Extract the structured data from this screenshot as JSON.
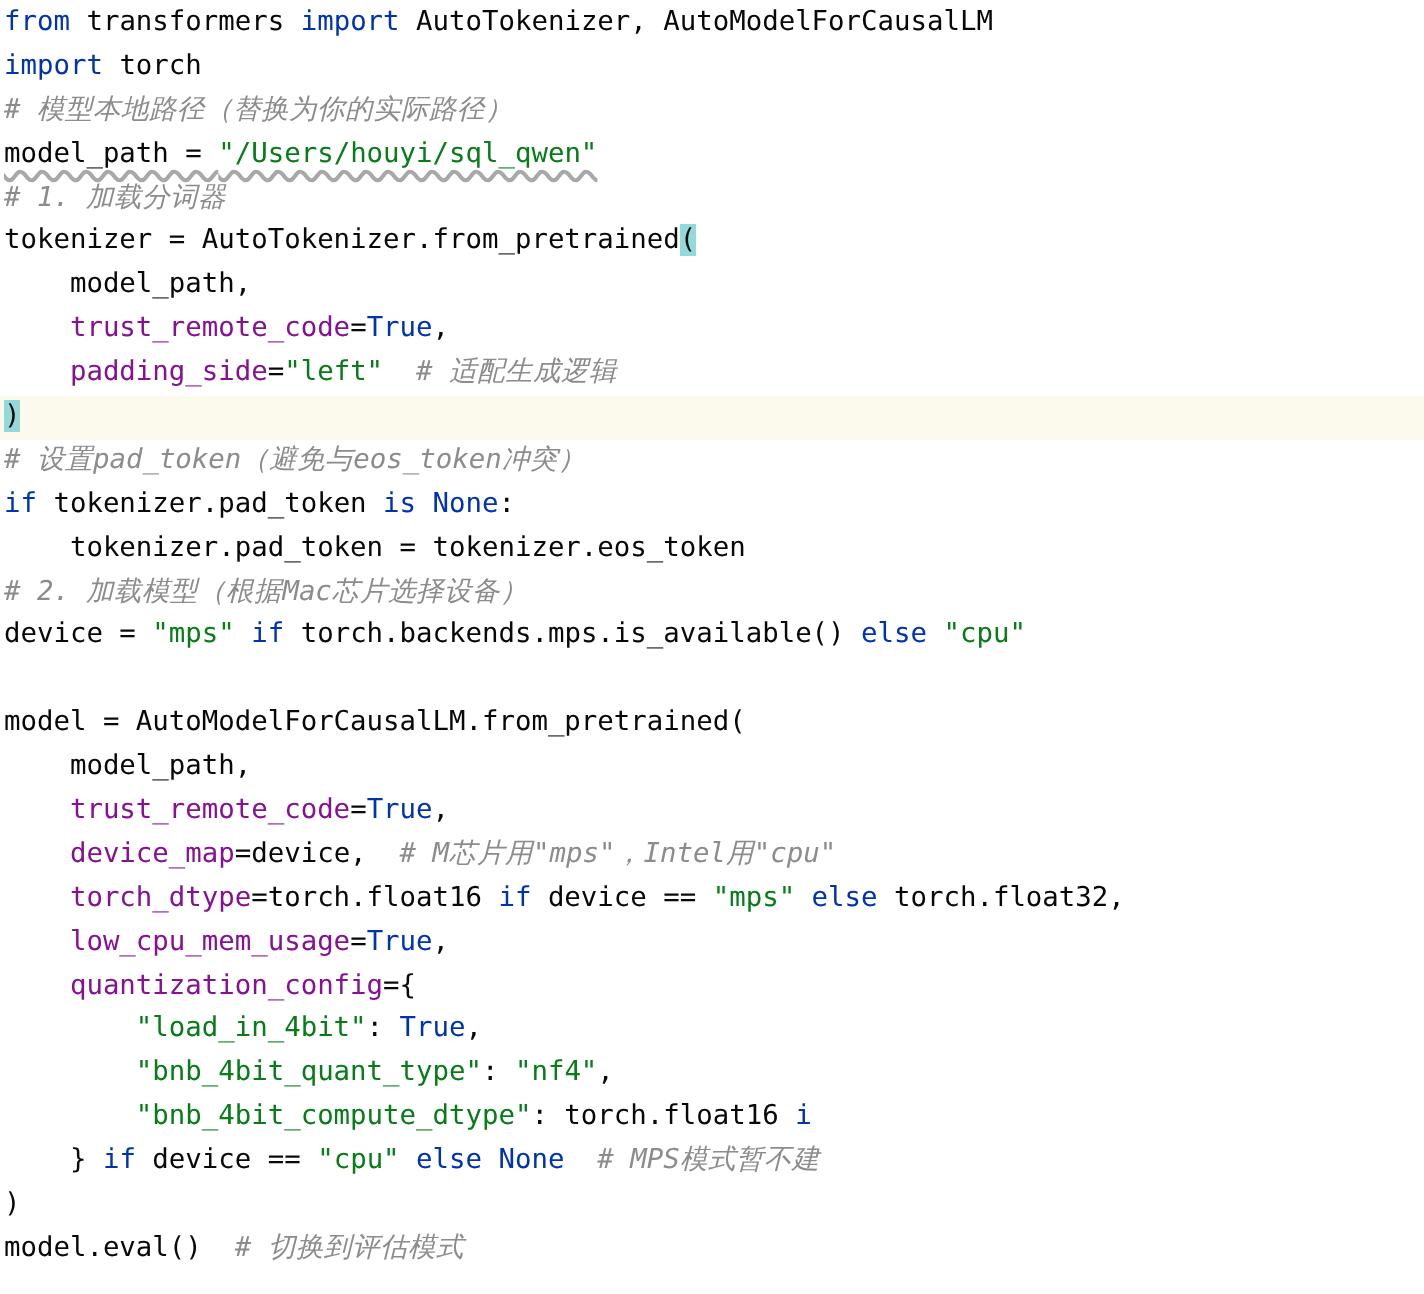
{
  "editor": {
    "lines": [
      {
        "current": false,
        "warned": false,
        "segments": [
          {
            "kind": "keyword",
            "text": "from"
          },
          {
            "kind": "plain",
            "text": " transformers "
          },
          {
            "kind": "keyword",
            "text": "import"
          },
          {
            "kind": "plain",
            "text": " AutoTokenizer, AutoModelForCausalLM"
          }
        ]
      },
      {
        "current": false,
        "warned": false,
        "segments": [
          {
            "kind": "keyword",
            "text": "import"
          },
          {
            "kind": "plain",
            "text": " torch"
          }
        ]
      },
      {
        "current": false,
        "warned": false,
        "segments": [
          {
            "kind": "comment",
            "text": "# 模型本地路径（替换为你的实际路径）"
          }
        ]
      },
      {
        "current": false,
        "warned": true,
        "segments": [
          {
            "kind": "plain",
            "text": "model_path = "
          },
          {
            "kind": "string",
            "text": "\"/Users/houyi/sql_qwen\""
          }
        ]
      },
      {
        "current": false,
        "warned": false,
        "segments": [
          {
            "kind": "comment",
            "text": "# 1. 加载分词器"
          }
        ]
      },
      {
        "current": false,
        "warned": false,
        "segments": [
          {
            "kind": "plain",
            "text": "tokenizer = AutoTokenizer.from_pretrained"
          },
          {
            "kind": "brace_match",
            "text": "("
          }
        ]
      },
      {
        "current": false,
        "warned": false,
        "segments": [
          {
            "kind": "plain",
            "text": "    model_path,"
          }
        ]
      },
      {
        "current": false,
        "warned": false,
        "segments": [
          {
            "kind": "param",
            "text": "    trust_remote_code"
          },
          {
            "kind": "plain",
            "text": "="
          },
          {
            "kind": "keyword",
            "text": "True"
          },
          {
            "kind": "plain",
            "text": ","
          }
        ]
      },
      {
        "current": false,
        "warned": false,
        "segments": [
          {
            "kind": "param",
            "text": "    padding_side"
          },
          {
            "kind": "plain",
            "text": "="
          },
          {
            "kind": "string",
            "text": "\"left\""
          },
          {
            "kind": "comment",
            "text": "  # 适配生成逻辑"
          }
        ]
      },
      {
        "current": true,
        "warned": false,
        "segments": [
          {
            "kind": "brace_match",
            "text": ")"
          }
        ]
      },
      {
        "current": false,
        "warned": false,
        "segments": [
          {
            "kind": "comment",
            "text": "# 设置pad_token（避免与eos_token冲突）"
          }
        ]
      },
      {
        "current": false,
        "warned": false,
        "segments": [
          {
            "kind": "keyword",
            "text": "if"
          },
          {
            "kind": "plain",
            "text": " tokenizer.pad_token "
          },
          {
            "kind": "keyword",
            "text": "is None"
          },
          {
            "kind": "plain",
            "text": ":"
          }
        ]
      },
      {
        "current": false,
        "warned": false,
        "segments": [
          {
            "kind": "plain",
            "text": "    tokenizer.pad_token = tokenizer.eos_token"
          }
        ]
      },
      {
        "current": false,
        "warned": false,
        "segments": [
          {
            "kind": "comment",
            "text": "# 2. 加载模型（根据Mac芯片选择设备）"
          }
        ]
      },
      {
        "current": false,
        "warned": false,
        "segments": [
          {
            "kind": "plain",
            "text": "device = "
          },
          {
            "kind": "string",
            "text": "\"mps\""
          },
          {
            "kind": "keyword",
            "text": " if"
          },
          {
            "kind": "plain",
            "text": " torch.backends.mps.is_available() "
          },
          {
            "kind": "keyword",
            "text": "else"
          },
          {
            "kind": "string",
            "text": " \"cpu\""
          }
        ]
      },
      {
        "current": false,
        "warned": false
      },
      {
        "current": false,
        "warned": false,
        "segments": [
          {
            "kind": "plain",
            "text": "model = AutoModelForCausalLM.from_pretrained("
          }
        ]
      },
      {
        "current": false,
        "warned": false,
        "segments": [
          {
            "kind": "plain",
            "text": "    model_path,"
          }
        ]
      },
      {
        "current": false,
        "warned": false,
        "segments": [
          {
            "kind": "param",
            "text": "    trust_remote_code"
          },
          {
            "kind": "plain",
            "text": "="
          },
          {
            "kind": "keyword",
            "text": "True"
          },
          {
            "kind": "plain",
            "text": ","
          }
        ]
      },
      {
        "current": false,
        "warned": false,
        "segments": [
          {
            "kind": "param",
            "text": "    device_map"
          },
          {
            "kind": "plain",
            "text": "=device,"
          },
          {
            "kind": "comment",
            "text": "  # M芯片用\"mps\"，Intel用\"cpu\""
          }
        ]
      },
      {
        "current": false,
        "warned": false,
        "segments": [
          {
            "kind": "param",
            "text": "    torch_dtype"
          },
          {
            "kind": "plain",
            "text": "=torch.float16 "
          },
          {
            "kind": "keyword",
            "text": "if"
          },
          {
            "kind": "plain",
            "text": " device == "
          },
          {
            "kind": "string",
            "text": "\"mps\""
          },
          {
            "kind": "keyword",
            "text": " else"
          },
          {
            "kind": "plain",
            "text": " torch.float32,"
          }
        ]
      },
      {
        "current": false,
        "warned": false,
        "segments": [
          {
            "kind": "param",
            "text": "    low_cpu_mem_usage"
          },
          {
            "kind": "plain",
            "text": "="
          },
          {
            "kind": "keyword",
            "text": "True"
          },
          {
            "kind": "plain",
            "text": ","
          }
        ]
      },
      {
        "current": false,
        "warned": false,
        "segments": [
          {
            "kind": "param",
            "text": "    quantization_config"
          },
          {
            "kind": "plain",
            "text": "={"
          }
        ]
      },
      {
        "current": false,
        "warned": false,
        "segments": [
          {
            "kind": "string",
            "text": "        \"load_in_4bit\""
          },
          {
            "kind": "plain",
            "text": ": "
          },
          {
            "kind": "keyword",
            "text": "True"
          },
          {
            "kind": "plain",
            "text": ","
          }
        ]
      },
      {
        "current": false,
        "warned": false,
        "segments": [
          {
            "kind": "string",
            "text": "        \"bnb_4bit_quant_type\""
          },
          {
            "kind": "plain",
            "text": ": "
          },
          {
            "kind": "string",
            "text": "\"nf4\""
          },
          {
            "kind": "plain",
            "text": ","
          }
        ]
      },
      {
        "current": false,
        "warned": false,
        "segments": [
          {
            "kind": "string",
            "text": "        \"bnb_4bit_compute_dtype\""
          },
          {
            "kind": "plain",
            "text": ": torch.float16 "
          },
          {
            "kind": "keyword",
            "text": "i"
          }
        ]
      },
      {
        "current": false,
        "warned": false,
        "segments": [
          {
            "kind": "plain",
            "text": "    } "
          },
          {
            "kind": "keyword",
            "text": "if"
          },
          {
            "kind": "plain",
            "text": " device == "
          },
          {
            "kind": "string",
            "text": "\"cpu\""
          },
          {
            "kind": "keyword",
            "text": " else None"
          },
          {
            "kind": "comment",
            "text": "  # MPS模式暂不建"
          }
        ]
      },
      {
        "current": false,
        "warned": false,
        "segments": [
          {
            "kind": "plain",
            "text": ")"
          }
        ]
      },
      {
        "current": false,
        "warned": false,
        "segments": [
          {
            "kind": "plain",
            "text": "model.eval()"
          },
          {
            "kind": "comment",
            "text": "  # 切换到评估模式"
          }
        ]
      }
    ]
  }
}
